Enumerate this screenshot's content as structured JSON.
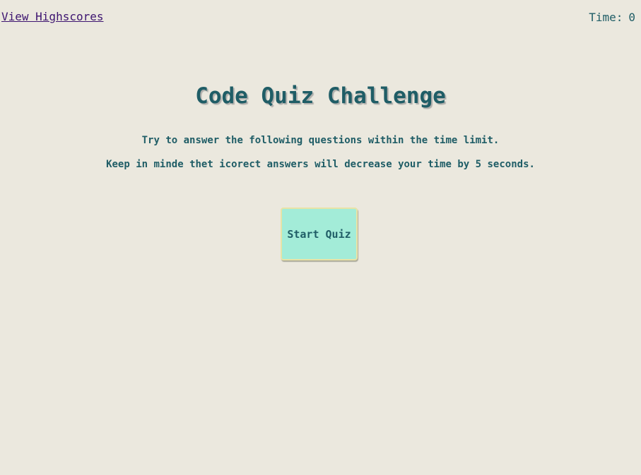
{
  "header": {
    "highscores_link": "View Highscores",
    "timer_label": "Time:",
    "timer_value": "0"
  },
  "main": {
    "title": "Code Quiz Challenge",
    "intro_line_1": "Try to answer the following questions within the time limit.",
    "intro_line_2": "Keep in minde thet icorect answers will decrease your time by 5 seconds.",
    "start_button": "Start Quiz"
  },
  "colors": {
    "background": "#ebe8de",
    "text": "#1f5d66",
    "link": "#3d1470",
    "button_fill": "#a3ecd8",
    "button_border": "#e8e3a6"
  }
}
